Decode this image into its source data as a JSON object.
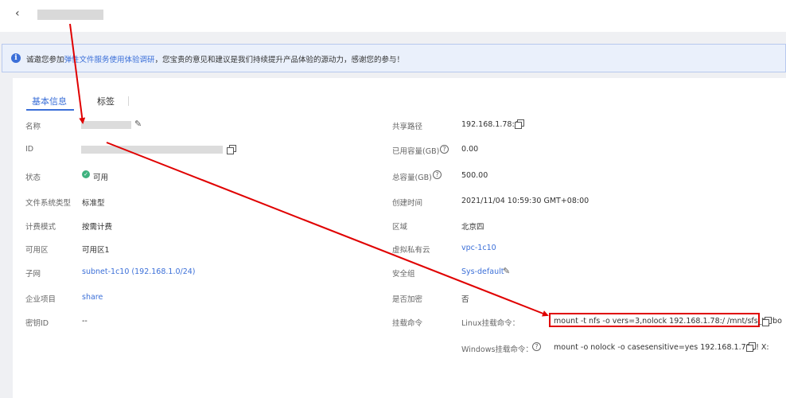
{
  "header": {
    "back_icon": "chevron-left-icon"
  },
  "notice": {
    "prefix": "诚邀您参加",
    "link": "弹性文件服务使用体验调研",
    "suffix": "，您宝贵的意见和建议是我们持续提升产品体验的源动力，感谢您的参与！"
  },
  "tabs": [
    {
      "label": "基本信息",
      "active": true
    },
    {
      "label": "标签",
      "active": false
    }
  ],
  "left": {
    "name_label": "名称",
    "id_label": "ID",
    "status_label": "状态",
    "status_value": "可用",
    "type_label": "文件系统类型",
    "type_value": "标准型",
    "billing_label": "计费模式",
    "billing_value": "按需计费",
    "az_label": "可用区",
    "az_value": "可用区1",
    "subnet_label": "子网",
    "subnet_value": "subnet-1c10 (192.168.1.0/24)",
    "project_label": "企业项目",
    "project_value": "share",
    "key_label": "密钥ID",
    "key_value": "--"
  },
  "right": {
    "share_path_label": "共享路径",
    "share_path_value": "192.168.1.78:/",
    "used_label": "已用容量(GB)",
    "used_value": "0.00",
    "total_label": "总容量(GB)",
    "total_value": "500.00",
    "created_label": "创建时间",
    "created_value": "2021/11/04 10:59:30 GMT+08:00",
    "region_label": "区域",
    "region_value": "北京四",
    "vpc_label": "虚拟私有云",
    "vpc_value": "vpc-1c10",
    "sg_label": "安全组",
    "sg_value": "Sys-default",
    "encrypted_label": "是否加密",
    "encrypted_value": "否",
    "mount_label": "挂载命令",
    "linux_label": "Linux挂载命令：",
    "linux_cmd": "mount -t nfs -o vers=3,nolock 192.168.1.78:/ /mnt/sfs_turbo",
    "windows_label": "Windows挂载命令：",
    "windows_cmd": "mount -o nolock -o casesensitive=yes 192.168.1.78:/! X:"
  },
  "colors": {
    "accent": "#3b6fd8",
    "success": "#3fb27f",
    "highlight": "#e00000"
  }
}
